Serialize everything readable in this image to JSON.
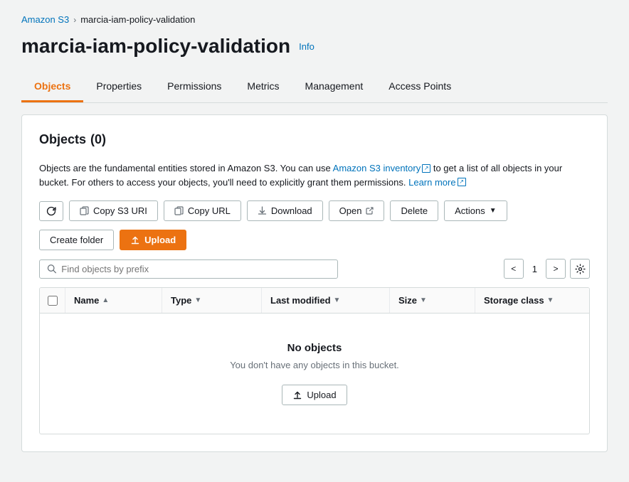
{
  "breadcrumb": {
    "parent_label": "Amazon S3",
    "separator": "›",
    "current": "marcia-iam-policy-validation"
  },
  "page": {
    "title": "marcia-iam-policy-validation",
    "info_label": "Info"
  },
  "tabs": [
    {
      "id": "objects",
      "label": "Objects",
      "active": true
    },
    {
      "id": "properties",
      "label": "Properties",
      "active": false
    },
    {
      "id": "permissions",
      "label": "Permissions",
      "active": false
    },
    {
      "id": "metrics",
      "label": "Metrics",
      "active": false
    },
    {
      "id": "management",
      "label": "Management",
      "active": false
    },
    {
      "id": "access-points",
      "label": "Access Points",
      "active": false
    }
  ],
  "objects_section": {
    "title": "Objects",
    "count": "(0)",
    "description_start": "Objects are the fundamental entities stored in Amazon S3. You can use ",
    "inventory_link": "Amazon S3 inventory",
    "description_middle": " to get a list of all objects in your bucket. For others to access your objects, you'll need to explicitly grant them permissions. ",
    "learn_more_link": "Learn more"
  },
  "toolbar": {
    "refresh_title": "Refresh",
    "copy_s3_uri_label": "Copy S3 URI",
    "copy_url_label": "Copy URL",
    "download_label": "Download",
    "open_label": "Open",
    "delete_label": "Delete",
    "actions_label": "Actions",
    "create_folder_label": "Create folder",
    "upload_label": "Upload"
  },
  "search": {
    "placeholder": "Find objects by prefix"
  },
  "pagination": {
    "current_page": "1",
    "prev_label": "<",
    "next_label": ">"
  },
  "table": {
    "columns": [
      {
        "id": "name",
        "label": "Name",
        "sortable": true
      },
      {
        "id": "type",
        "label": "Type",
        "sortable": true
      },
      {
        "id": "last_modified",
        "label": "Last modified",
        "sortable": true
      },
      {
        "id": "size",
        "label": "Size",
        "sortable": true
      },
      {
        "id": "storage_class",
        "label": "Storage class",
        "sortable": true
      }
    ],
    "rows": []
  },
  "empty_state": {
    "title": "No objects",
    "description": "You don't have any objects in this bucket.",
    "upload_label": "Upload"
  }
}
